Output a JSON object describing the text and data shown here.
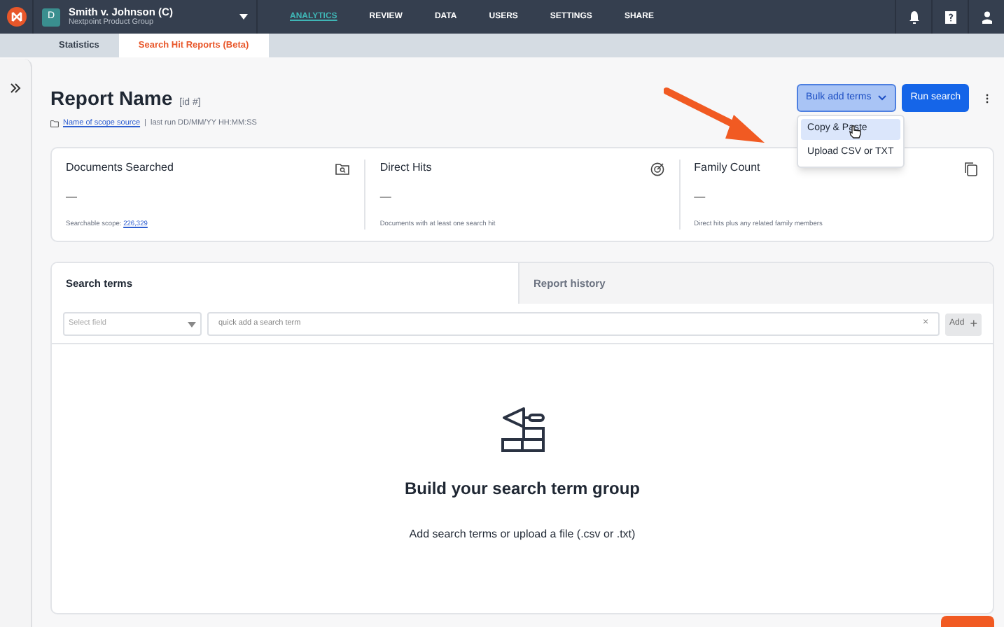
{
  "top_bar": {
    "project_initial": "D",
    "project_name": "Smith v. Johnson (C)",
    "project_group": "Nextpoint Product Group",
    "nav": [
      {
        "label": "ANALYTICS",
        "selected": true
      },
      {
        "label": "REVIEW",
        "selected": false
      },
      {
        "label": "DATA",
        "selected": false
      },
      {
        "label": "USERS",
        "selected": false
      },
      {
        "label": "SETTINGS",
        "selected": false
      },
      {
        "label": "SHARE",
        "selected": false
      }
    ]
  },
  "sub_tabs": [
    {
      "label": "Statistics",
      "selected": false
    },
    {
      "label": "Search Hit Reports (Beta)",
      "selected": true
    }
  ],
  "report": {
    "title": "Report Name",
    "id": "[id #]",
    "scope_link": "Name of scope source",
    "separator": "|",
    "last_run": "last run DD/MM/YY HH:MM:SS"
  },
  "actions": {
    "bulk_button": "Bulk add terms",
    "run_button": "Run search",
    "menu": [
      {
        "label": "Copy & Paste",
        "selected": true
      },
      {
        "label": "Upload CSV or TXT",
        "selected": false
      }
    ]
  },
  "stats": [
    {
      "kind": "folder",
      "title": "Documents Searched",
      "value": "—",
      "note": "Searchable scope: ",
      "note_link": "226,329"
    },
    {
      "kind": "target",
      "title": "Direct Hits",
      "value": "—",
      "note": "Documents with at least one search hit"
    },
    {
      "kind": "copy",
      "title": "Family Count",
      "value": "—",
      "note": "Direct hits plus any related family members"
    }
  ],
  "panel_tabs": [
    {
      "label": "Search terms",
      "selected": true
    },
    {
      "label": "Report history",
      "selected": false
    }
  ],
  "field_select": {
    "placeholder": "Select field"
  },
  "term_input": {
    "placeholder": "quick add a search term"
  },
  "clear": "×",
  "add_button": "Add",
  "add_plus": "+",
  "empty_state": {
    "heading": "Build your search term group",
    "text": "Add search terms or upload a file (.csv or .txt)"
  }
}
